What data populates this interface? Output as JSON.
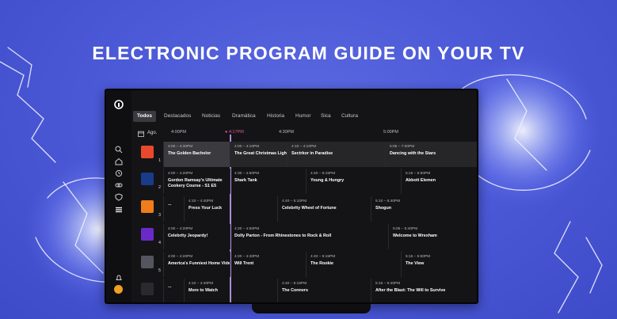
{
  "headline": "ELECTRONIC PROGRAM GUIDE ON YOUR TV",
  "tabs": [
    "Todos",
    "Destacados",
    "Noticias",
    "Dramática",
    "Historia",
    "Humor",
    "Sica",
    "Cultura"
  ],
  "active_tab": "Todos",
  "timebar": {
    "day": "Ago.",
    "t1": "4:00PM",
    "now": "● 4:17PM",
    "t2": "4:30PM",
    "t3": "5:00PM"
  },
  "icons": [
    "search-icon",
    "home-icon",
    "history-icon",
    "link-icon",
    "shield-icon",
    "list-icon",
    "bell-icon"
  ],
  "rows": [
    {
      "channel_num": "1",
      "logo_color": "#e8492c",
      "programs": [
        {
          "time": "4:00 – 4:30PM",
          "title": "The Golden Bachelor",
          "style": "hl"
        },
        {
          "time": "4:00 – 4:10PM",
          "title": "The Great Christmas Light Fight",
          "style": "cur"
        },
        {
          "time": "4:10 – 4:10PM",
          "title": "Sectrkor in Paradise",
          "style": "cur"
        },
        {
          "time": "5:05 – 7:00PM",
          "title": "Dancing with the Stars",
          "style": "cur"
        }
      ]
    },
    {
      "channel_num": "2",
      "logo_color": "#1a3a8a",
      "programs": [
        {
          "time": "4:00 – 4:20PM",
          "title": "Gordon Ramsay's Ultimate Cookery Course - S1 E5",
          "style": ""
        },
        {
          "time": "4:30 – 4:50PM",
          "title": "Shark Tank",
          "style": ""
        },
        {
          "time": "4:40 – 5:15PM",
          "title": "Young & Hungry",
          "style": ""
        },
        {
          "time": "5:15 – 5:50PM",
          "title": "Abbott Elemen",
          "style": ""
        }
      ]
    },
    {
      "channel_num": "3",
      "logo_color": "#f07c1a",
      "programs": [
        {
          "time": "",
          "title": "...",
          "style": ""
        },
        {
          "time": "4:10 – 4:40PM",
          "title": "Press Your Luck",
          "style": ""
        },
        {
          "time": "4:40 – 5:10PM",
          "title": "Celebrity Wheel of Fortune",
          "style": ""
        },
        {
          "time": "5:10 – 6:40PM",
          "title": "Shogun",
          "style": ""
        }
      ]
    },
    {
      "channel_num": "4",
      "logo_color": "#6a2ac8",
      "programs": [
        {
          "time": "4:00 – 4:20PM",
          "title": "Celebrity Jeopardy!",
          "style": ""
        },
        {
          "time": "4:20 – 4:50PM",
          "title": "Dolly Parton - From Rhinestones to Rock & Roll",
          "style": ""
        },
        {
          "time": "5:05 – 5:40PM",
          "title": "Welcome to Wrexham",
          "style": ""
        }
      ]
    },
    {
      "channel_num": "5",
      "logo_color": "#555560",
      "programs": [
        {
          "time": "4:00 – 4:20PM",
          "title": "America's Funniest Home Videos",
          "style": ""
        },
        {
          "time": "4:20 – 4:40PM",
          "title": "Will Trent",
          "style": ""
        },
        {
          "time": "4:40 – 5:15PM",
          "title": "The Rookie",
          "style": ""
        },
        {
          "time": "5:15 – 5:50PM",
          "title": "The View",
          "style": ""
        }
      ]
    },
    {
      "channel_num": "",
      "logo_color": "#2a2a2e",
      "programs": [
        {
          "time": "",
          "title": "...",
          "style": ""
        },
        {
          "time": "4:10 – 4:40PM",
          "title": "More to Watch",
          "style": ""
        },
        {
          "time": "4:40 – 5:15PM",
          "title": "The Conners",
          "style": ""
        },
        {
          "time": "5:15 – 5:40PM",
          "title": "After the Blast: The Will to Survive",
          "style": ""
        }
      ]
    }
  ]
}
